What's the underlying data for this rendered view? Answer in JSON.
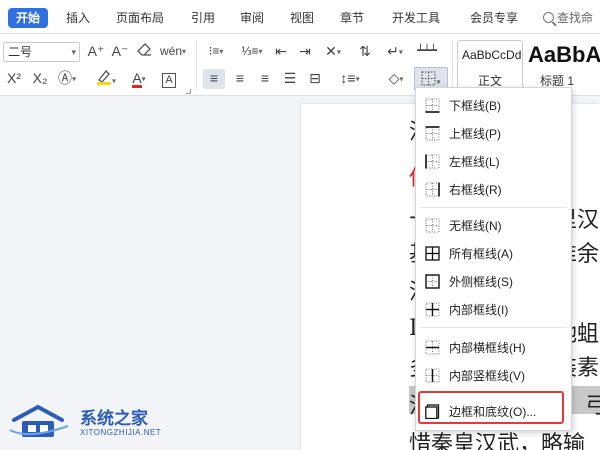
{
  "tabs": [
    {
      "label": "开始",
      "active": true
    },
    {
      "label": "插入"
    },
    {
      "label": "页面布局"
    },
    {
      "label": "引用"
    },
    {
      "label": "审阅"
    },
    {
      "label": "视图"
    },
    {
      "label": "章节"
    },
    {
      "label": "开发工具"
    },
    {
      "label": "会员专享"
    }
  ],
  "search": {
    "label": "查找命"
  },
  "ribbon": {
    "font_size_value": "二号",
    "font_grow": "A⁺",
    "font_shrink": "A⁻",
    "superscript": "X²",
    "subscript": "X₂",
    "font_color_glyph": "A",
    "char_border_glyph": "A",
    "style_normal_preview": "AaBbCcDd",
    "style_normal_name": "正文",
    "style_h1_preview": "AaBbA",
    "style_h1_name": "标题 1",
    "accent_color": "#2f6fe0",
    "font_color": "#e02424",
    "highlight_color": "#f5d90a"
  },
  "document": {
    "lines": [
      {
        "text": "汉",
        "color": "#222222"
      },
      {
        "text": "低",
        "color": "#e02424"
      },
      {
        "text": "十",
        "color": "#222222"
      },
      {
        "text": "里汉",
        "color": "#222222"
      },
      {
        "text": "基",
        "color": "#222222"
      },
      {
        "text": "准余",
        "color": "#222222"
      },
      {
        "text": "汉",
        "color": "#222222"
      },
      {
        "text": "L",
        "color": "#222222"
      },
      {
        "text": "驰蛆",
        "color": "#222222"
      },
      {
        "text": "多",
        "color": "#222222"
      },
      {
        "text": "装素",
        "color": "#222222"
      },
      {
        "text": "汉",
        "color": "#222222"
      },
      {
        "text": "弓",
        "color": "#222222"
      },
      {
        "text": "惜秦皇汉武，略输",
        "color": "#222222"
      }
    ]
  },
  "border_menu": {
    "items": [
      {
        "label": "下框线(B)",
        "icon": "bottom-border-icon"
      },
      {
        "label": "上框线(P)",
        "icon": "top-border-icon"
      },
      {
        "label": "左框线(L)",
        "icon": "left-border-icon"
      },
      {
        "label": "右框线(R)",
        "icon": "right-border-icon"
      },
      {
        "label": "无框线(N)",
        "icon": "no-border-icon"
      },
      {
        "label": "所有框线(A)",
        "icon": "all-borders-icon"
      },
      {
        "label": "外侧框线(S)",
        "icon": "outside-borders-icon"
      },
      {
        "label": "内部框线(I)",
        "icon": "inside-borders-icon"
      },
      {
        "label": "内部横框线(H)",
        "icon": "inside-horizontal-border-icon"
      },
      {
        "label": "内部竖框线(V)",
        "icon": "inside-vertical-border-icon"
      },
      {
        "label": "边框和底纹(O)...",
        "icon": "borders-and-shading-icon"
      }
    ],
    "highlight_color": "#e53935"
  },
  "watermark": {
    "title": "系统之家",
    "subtitle": "XITONGZHIJIA.NET",
    "color": "#2b5db8"
  }
}
